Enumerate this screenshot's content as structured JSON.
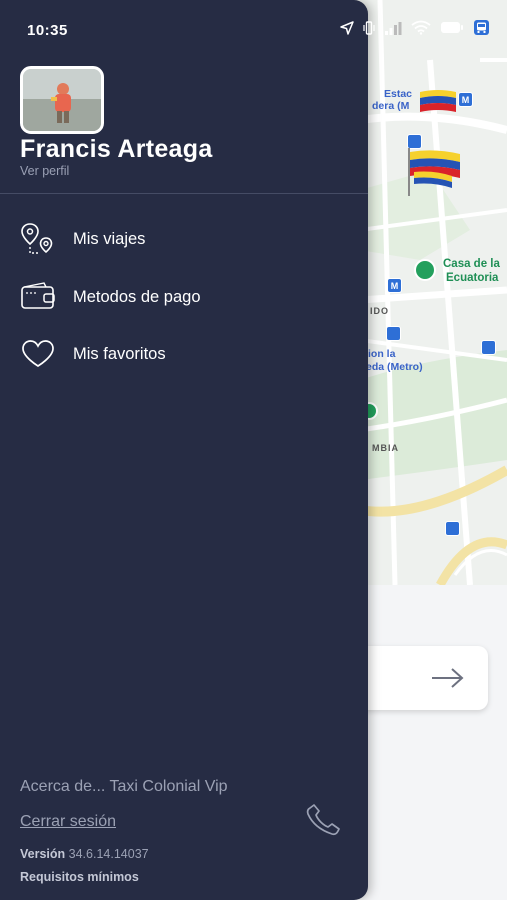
{
  "status_bar": {
    "time": "10:35",
    "icons": [
      "location-arrow-icon",
      "vibrate-icon",
      "signal-icon",
      "wifi-icon",
      "battery-icon",
      "bus-notification-icon"
    ]
  },
  "map": {
    "labels": {
      "station_line1": "Estac",
      "station_line2": "dera (M",
      "casa_line1": "Casa de la",
      "casa_line2": "Ecuatoria",
      "ido": "IDO",
      "metro_line1": "ion la",
      "metro_line2": "eda (Metro)",
      "mbia": "MBIA"
    },
    "metro_badge": "M"
  },
  "drawer": {
    "user": {
      "name": "Francis Arteaga",
      "view_profile": "Ver perfil"
    },
    "menu": [
      {
        "label": "Mis viajes",
        "icon": "route-pins-icon"
      },
      {
        "label": "Metodos de pago",
        "icon": "wallet-icon"
      },
      {
        "label": "Mis favoritos",
        "icon": "heart-icon"
      }
    ],
    "footer": {
      "about": "Acerca de... Taxi Colonial Vip",
      "logout": "Cerrar sesión",
      "version_label": "Versión",
      "version_value": "34.6.14.14037",
      "requirements": "Requisitos mínimos",
      "phone_icon": "phone-icon"
    }
  },
  "colors": {
    "drawer_bg": "#262c44",
    "metro_blue": "#2e6fd6",
    "poi_green": "#23a05d"
  }
}
